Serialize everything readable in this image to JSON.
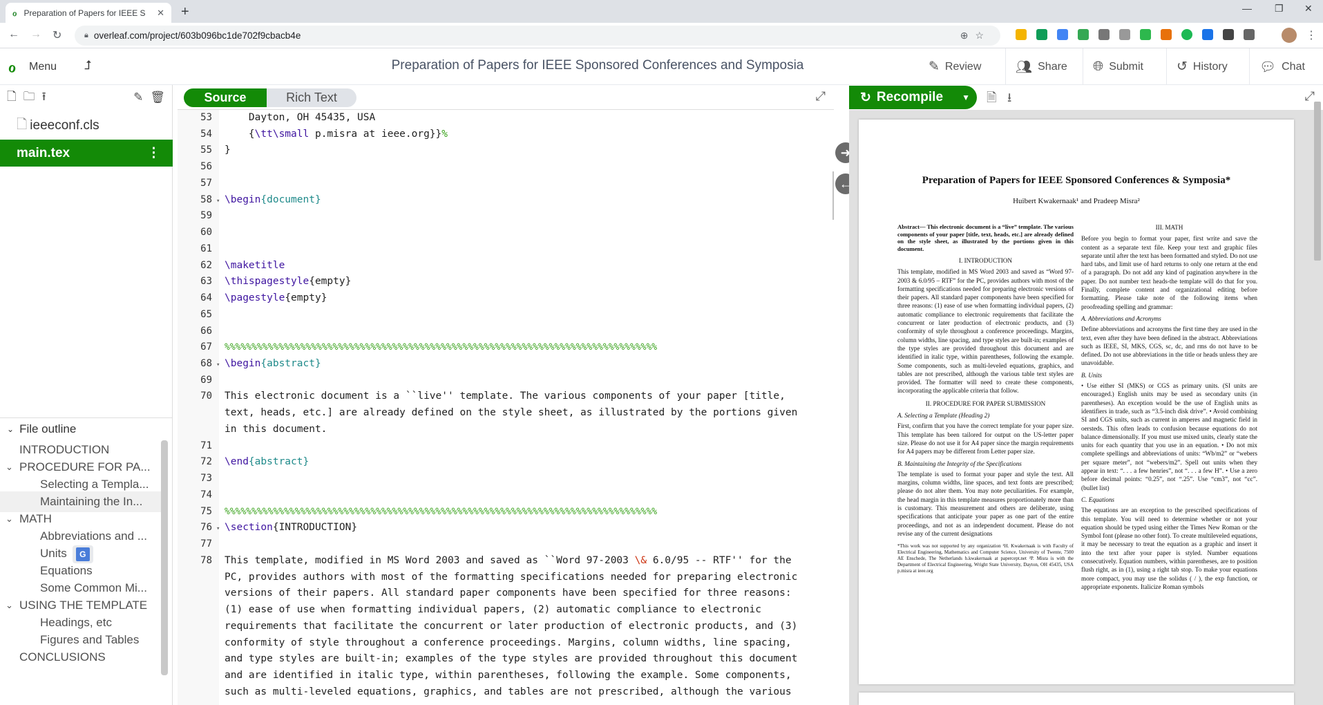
{
  "browser": {
    "tab_title": "Preparation of Papers for IEEE S",
    "url": "overleaf.com/project/603b096bc1de702f9cbacb4e"
  },
  "toolbar": {
    "menu": "Menu",
    "project_title": "Preparation of Papers for IEEE Sponsored Conferences and Symposia",
    "review": "Review",
    "share": "Share",
    "submit": "Submit",
    "history": "History",
    "chat": "Chat"
  },
  "files": [
    {
      "name": "ieeeconf.cls"
    },
    {
      "name": "main.tex"
    }
  ],
  "outline": {
    "header": "File outline",
    "items": [
      "INTRODUCTION",
      "PROCEDURE FOR PA...",
      "Selecting a Templa...",
      "Maintaining the In...",
      "MATH",
      "Abbreviations and ...",
      "Units",
      "Equations",
      "Some Common Mi...",
      "USING THE TEMPLATE",
      "Headings, etc",
      "Figures and Tables",
      "CONCLUSIONS"
    ]
  },
  "editor": {
    "source": "Source",
    "rich_text": "Rich Text",
    "lines": {
      "n53": "53",
      "t53": "    Dayton, OH 45435, USA",
      "n54": "54",
      "t54a": "    {",
      "t54b": "\\tt\\small",
      "t54c": " p.misra at ieee.org}}",
      "t54d": "%",
      "n55": "55",
      "t55": "}",
      "n56": "56",
      "n57": "57",
      "n58": "58",
      "t58a": "\\begin",
      "t58b": "{document}",
      "n59": "59",
      "n60": "60",
      "n61": "61",
      "n62": "62",
      "t62": "\\maketitle",
      "n63": "63",
      "t63a": "\\thispagestyle",
      "t63b": "{empty}",
      "n64": "64",
      "t64a": "\\pagestyle",
      "t64b": "{empty}",
      "n65": "65",
      "n66": "66",
      "n67": "67",
      "t67": "%%%%%%%%%%%%%%%%%%%%%%%%%%%%%%%%%%%%%%%%%%%%%%%%%%%%%%%%%%%%%%%%%%%%%%%%%%%%%%%%",
      "n68": "68",
      "t68a": "\\begin",
      "t68b": "{abstract}",
      "n69": "69",
      "n70": "70",
      "t70a": "This electronic document is a ``live'' template. The various components of your paper [title,",
      "t70b": "text, heads, etc.] are already defined on the style sheet, as illustrated by the portions given",
      "t70c": "in this document.",
      "n71": "71",
      "n72": "72",
      "t72a": "\\end",
      "t72b": "{abstract}",
      "n73": "73",
      "n74": "74",
      "n75": "75",
      "t75": "%%%%%%%%%%%%%%%%%%%%%%%%%%%%%%%%%%%%%%%%%%%%%%%%%%%%%%%%%%%%%%%%%%%%%%%%%%%%%%%%",
      "n76": "76",
      "t76a": "\\section",
      "t76b": "{INTRODUCTION}",
      "n77": "77",
      "n78": "78",
      "t78a": "This template, modified in MS Word 2003 and saved as ``Word 97-2003 ",
      "t78amp": "\\&",
      "t78a2": " 6.0/95 -- RTF'' for the",
      "t78b": "PC, provides authors with most of the formatting specifications needed for preparing electronic",
      "t78c": "versions of their papers. All standard paper components have been specified for three reasons:",
      "t78d": "(1) ease of use when formatting individual papers, (2) automatic compliance to electronic",
      "t78e": "requirements that facilitate the concurrent or later production of electronic products, and (3)",
      "t78f": "conformity of style throughout a conference proceedings. Margins, column widths, line spacing,",
      "t78g": "and type styles are built-in; examples of the type styles are provided throughout this document",
      "t78h": "and are identified in italic type, within parentheses, following the example. Some components,",
      "t78i": "such as multi-leveled equations, graphics, and tables are not prescribed, although the various"
    }
  },
  "pdf": {
    "recompile": "Recompile",
    "title": "Preparation of Papers for IEEE Sponsored Conferences & Symposia*",
    "authors": "Huibert Kwakernaak¹ and Pradeep Misra²",
    "abstract": "Abstract— This electronic document is a “live” template. The various components of your paper [title, text, heads, etc.] are already defined on the style sheet, as illustrated by the portions given in this document.",
    "intro_h": "I. INTRODUCTION",
    "intro": "This template, modified in MS Word 2003 and saved as “Word 97-2003 & 6.0/95 – RTF” for the PC, provides authors with most of the formatting specifications needed for preparing electronic versions of their papers. All standard paper components have been specified for three reasons: (1) ease of use when formatting individual papers, (2) automatic compliance to electronic requirements that facilitate the concurrent or later production of electronic products, and (3) conformity of style throughout a conference proceedings. Margins, column widths, line spacing, and type styles are built-in; examples of the type styles are provided throughout this document and are identified in italic type, within parentheses, following the example. Some components, such as multi-leveled equations, graphics, and tables are not prescribed, although the various table text styles are provided. The formatter will need to create these components, incorporating the applicable criteria that follow.",
    "proc_h": "II. PROCEDURE FOR PAPER SUBMISSION",
    "sel_h": "A. Selecting a Template (Heading 2)",
    "sel": "First, confirm that you have the correct template for your paper size. This template has been tailored for output on the US-letter paper size. Please do not use it for A4 paper since the margin requirements for A4 papers may be different from Letter paper size.",
    "maint_h": "B. Maintaining the Integrity of the Specifications",
    "maint": "The template is used to format your paper and style the text. All margins, column widths, line spaces, and text fonts are prescribed; please do not alter them. You may note peculiarities. For example, the head margin in this template measures proportionately more than is customary. This measurement and others are deliberate, using specifications that anticipate your paper as one part of the entire proceedings, and not as an independent document. Please do not revise any of the current designations",
    "foot": "*This work was not supported by any organization ¹H. Kwakernaak is with Faculty of Electrical Engineering, Mathematics and Computer Science, University of Twente, 7500 AE Enschede, The Netherlands h.kwakernaak at papercept.net ²P. Misra is with the Department of Electrical Engineering, Wright State University, Dayton, OH 45435, USA p.misra at ieee.org",
    "math_h": "III. MATH",
    "math": "Before you begin to format your paper, first write and save the content as a separate text file. Keep your text and graphic files separate until after the text has been formatted and styled. Do not use hard tabs, and limit use of hard returns to only one return at the end of a paragraph. Do not add any kind of pagination anywhere in the paper. Do not number text heads-the template will do that for you. Finally, complete content and organizational editing before formatting. Please take note of the following items when proofreading spelling and grammar:",
    "abbr_h": "A. Abbreviations and Acronyms",
    "abbr": "Define abbreviations and acronyms the first time they are used in the text, even after they have been defined in the abstract. Abbreviations such as IEEE, SI, MKS, CGS, sc, dc, and rms do not have to be defined. Do not use abbreviations in the title or heads unless they are unavoidable.",
    "units_h": "B. Units",
    "units": "• Use either SI (MKS) or CGS as primary units. (SI units are encouraged.) English units may be used as secondary units (in parentheses). An exception would be the use of English units as identifiers in trade, such as “3.5-inch disk drive”. • Avoid combining SI and CGS units, such as current in amperes and magnetic field in oersteds. This often leads to confusion because equations do not balance dimensionally. If you must use mixed units, clearly state the units for each quantity that you use in an equation. • Do not mix complete spellings and abbreviations of units: “Wb/m2” or “webers per square meter”, not “webers/m2”. Spell out units when they appear in text: “. . . a few henries”, not “. . . a few H”. • Use a zero before decimal points: “0.25”, not “.25”. Use “cm3”, not “cc”. (bullet list)",
    "eq_h": "C. Equations",
    "eq": "The equations are an exception to the prescribed specifications of this template. You will need to determine whether or not your equation should be typed using either the Times New Roman or the Symbol font (please no other font). To create multileveled equations, it may be necessary to treat the equation as a graphic and insert it into the text after your paper is styled. Number equations consecutively. Equation numbers, within parentheses, are to position flush right, as in (1), using a right tab stop. To make your equations more compact, you may use the solidus ( / ), the exp function, or appropriate exponents. Italicize Roman symbols"
  },
  "colors": {
    "overleaf_green": "#138a07"
  }
}
